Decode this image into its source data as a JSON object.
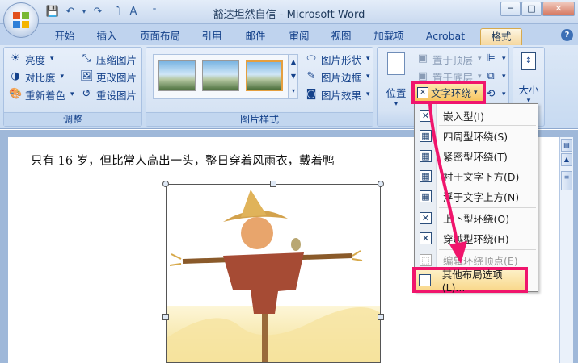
{
  "titlebar": {
    "title": "豁达坦然自信 - Microsoft Word",
    "minimize": "─",
    "maximize": "□",
    "close": "✕"
  },
  "tabs": [
    "开始",
    "插入",
    "页面布局",
    "引用",
    "邮件",
    "审阅",
    "视图",
    "加载项",
    "Acrobat",
    "格式"
  ],
  "active_tab": "格式",
  "ribbon": {
    "adjust": {
      "label": "调整",
      "brightness": "亮度",
      "contrast": "对比度",
      "recolor": "重新着色",
      "compress": "压缩图片",
      "change": "更改图片",
      "reset": "重设图片"
    },
    "styles": {
      "label": "图片样式",
      "shape": "图片形状",
      "border": "图片边框",
      "effects": "图片效果"
    },
    "arrange": {
      "position": "位置",
      "bring_front": "置于顶层",
      "send_back": "置于底层",
      "wrap_text": "文字环绕"
    },
    "size": {
      "label": "大小"
    }
  },
  "document": {
    "text": "只有 16 岁，但比常人高出一头，整日穿着风雨衣，戴着鸭"
  },
  "wrap_menu": {
    "items": [
      {
        "label": "嵌入型(I)",
        "disabled": false
      },
      {
        "label": "四周型环绕(S)",
        "disabled": false
      },
      {
        "label": "紧密型环绕(T)",
        "disabled": false
      },
      {
        "label": "衬于文字下方(D)",
        "disabled": false
      },
      {
        "label": "浮于文字上方(N)",
        "disabled": false
      },
      {
        "label": "上下型环绕(O)",
        "disabled": false
      },
      {
        "label": "穿越型环绕(H)",
        "disabled": false
      },
      {
        "label": "编辑环绕顶点(E)",
        "disabled": true
      }
    ],
    "more": "其他布局选项(L)..."
  },
  "colors": {
    "highlight": "#f0156c",
    "ribbon_text": "#15428b"
  }
}
